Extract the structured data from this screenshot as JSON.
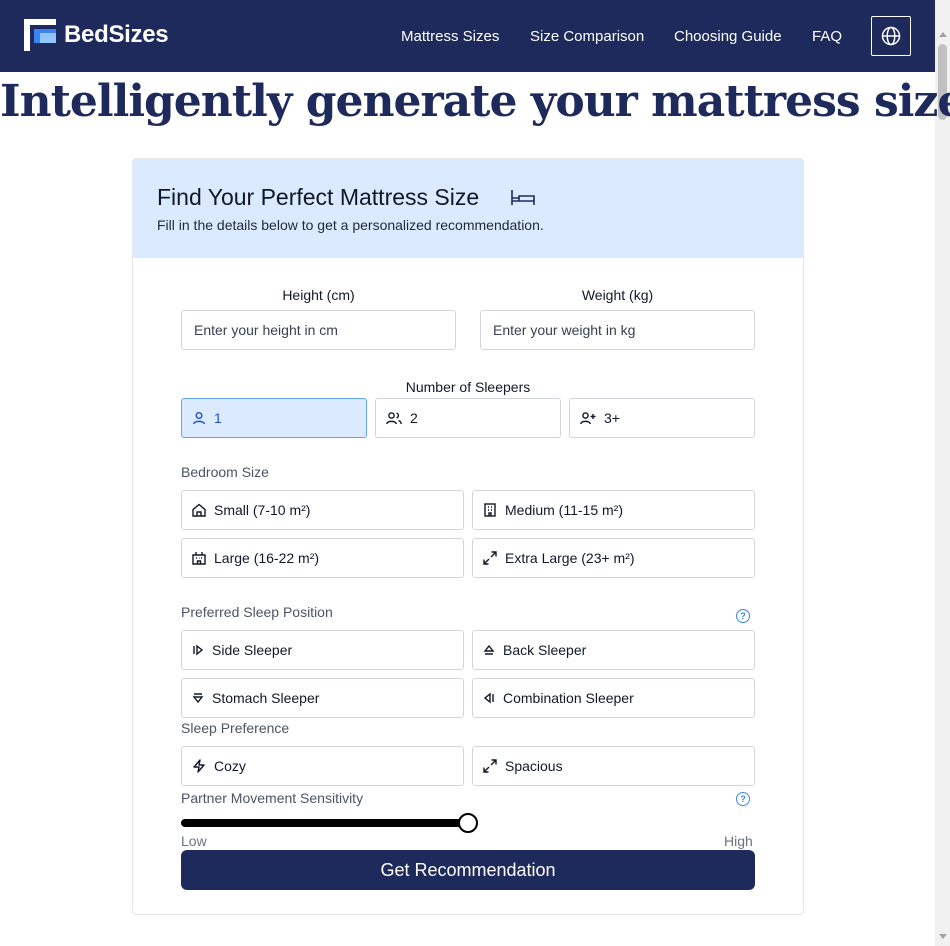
{
  "brand": {
    "name": "BedSizes"
  },
  "nav": {
    "links": [
      "Mattress Sizes",
      "Size Comparison",
      "Choosing Guide",
      "FAQ"
    ],
    "language_icon": "globe-icon"
  },
  "hero": {
    "title": "Intelligently generate your mattress size"
  },
  "card": {
    "title": "Find Your Perfect Mattress Size",
    "title_icon": "bed-icon",
    "subtitle": "Fill in the details below to get a personalized recommendation."
  },
  "form": {
    "height": {
      "label": "Height (cm)",
      "placeholder": "Enter your height in cm"
    },
    "weight": {
      "label": "Weight (kg)",
      "placeholder": "Enter your weight in kg"
    },
    "sleepers": {
      "label": "Number of Sleepers",
      "options": [
        {
          "label": "1",
          "icon": "user-icon",
          "selected": true
        },
        {
          "label": "2",
          "icon": "users-icon",
          "selected": false
        },
        {
          "label": "3+",
          "icon": "user-plus-icon",
          "selected": false
        }
      ]
    },
    "bedroom": {
      "label": "Bedroom Size",
      "options": [
        {
          "label": "Small (7-10 m²)",
          "icon": "home-icon"
        },
        {
          "label": "Medium (11-15 m²)",
          "icon": "building-icon"
        },
        {
          "label": "Large (16-22 m²)",
          "icon": "hotel-icon"
        },
        {
          "label": "Extra Large (23+ m²)",
          "icon": "expand-icon"
        }
      ]
    },
    "position": {
      "label": "Preferred Sleep Position",
      "options": [
        {
          "label": "Side Sleeper",
          "icon": "arrow-right-icon"
        },
        {
          "label": "Back Sleeper",
          "icon": "arrow-up-icon"
        },
        {
          "label": "Stomach Sleeper",
          "icon": "arrow-down-icon"
        },
        {
          "label": "Combination Sleeper",
          "icon": "arrow-left-icon"
        }
      ]
    },
    "preference": {
      "label": "Sleep Preference",
      "options": [
        {
          "label": "Cozy",
          "icon": "zap-icon"
        },
        {
          "label": "Spacious",
          "icon": "expand-icon"
        }
      ]
    },
    "movement": {
      "label": "Partner Movement Sensitivity",
      "low_label": "Low",
      "high_label": "High",
      "value_fraction": 0.5
    },
    "submit_label": "Get Recommendation"
  },
  "colors": {
    "navy": "#1f2a5c",
    "header_bg": "#dbeafe",
    "accent": "#3b82f6"
  }
}
